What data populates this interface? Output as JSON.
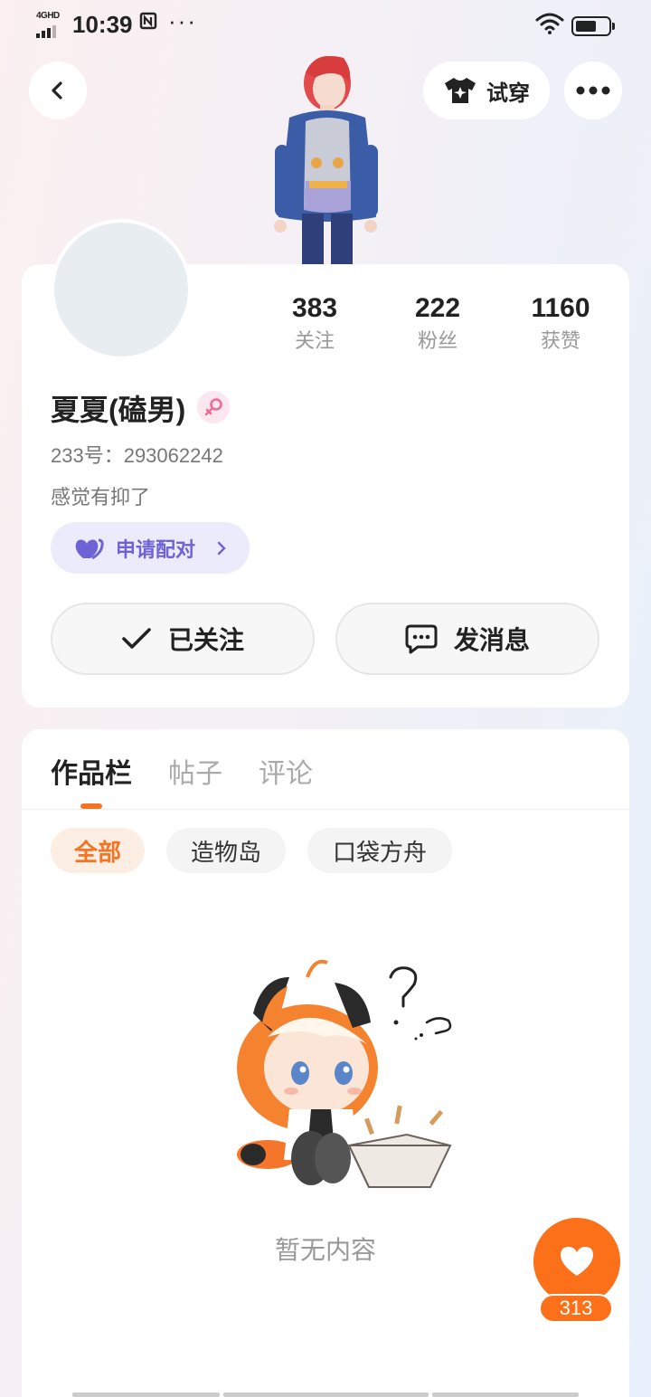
{
  "status_bar": {
    "network": "4GHD",
    "time": "10:39",
    "extra": "ᴺ",
    "dots": "···",
    "battery_level": 0.65
  },
  "nav": {
    "tryon_label": "试穿"
  },
  "profile": {
    "stats": [
      {
        "value": "383",
        "label": "关注"
      },
      {
        "value": "222",
        "label": "粉丝"
      },
      {
        "value": "1160",
        "label": "获赞"
      }
    ],
    "username": "夏夏(磕男)",
    "gender": "female",
    "uid": "233号：293062242",
    "bio": "感觉有抑了",
    "pair_label": "申请配对"
  },
  "actions": {
    "follow_label": "已关注",
    "message_label": "发消息"
  },
  "content": {
    "tabs": [
      "作品栏",
      "帖子",
      "评论"
    ],
    "active_tab": 0,
    "chips": [
      "全部",
      "造物岛",
      "口袋方舟"
    ],
    "active_chip": 0,
    "empty_text": "暂无内容",
    "like_count": "313"
  },
  "colors": {
    "accent": "#f57423",
    "pair": "#6e63d6",
    "fab": "#fb7019"
  }
}
